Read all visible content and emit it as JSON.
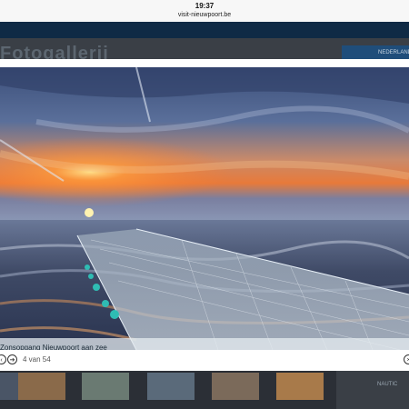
{
  "status_bar": {
    "time": "19:37",
    "url": "visit-nieuwpoort.be"
  },
  "page": {
    "heading": "Fotogallerij",
    "top_right_button": "NEDERLANDS"
  },
  "lightbox": {
    "caption": "Zonsopgang Nieuwpoort aan zee",
    "counter": "4 van 54",
    "prev_icon": "arrow-left-icon",
    "next_icon": "arrow-right-icon"
  },
  "side_panel": {
    "label": "NAUTIC"
  }
}
